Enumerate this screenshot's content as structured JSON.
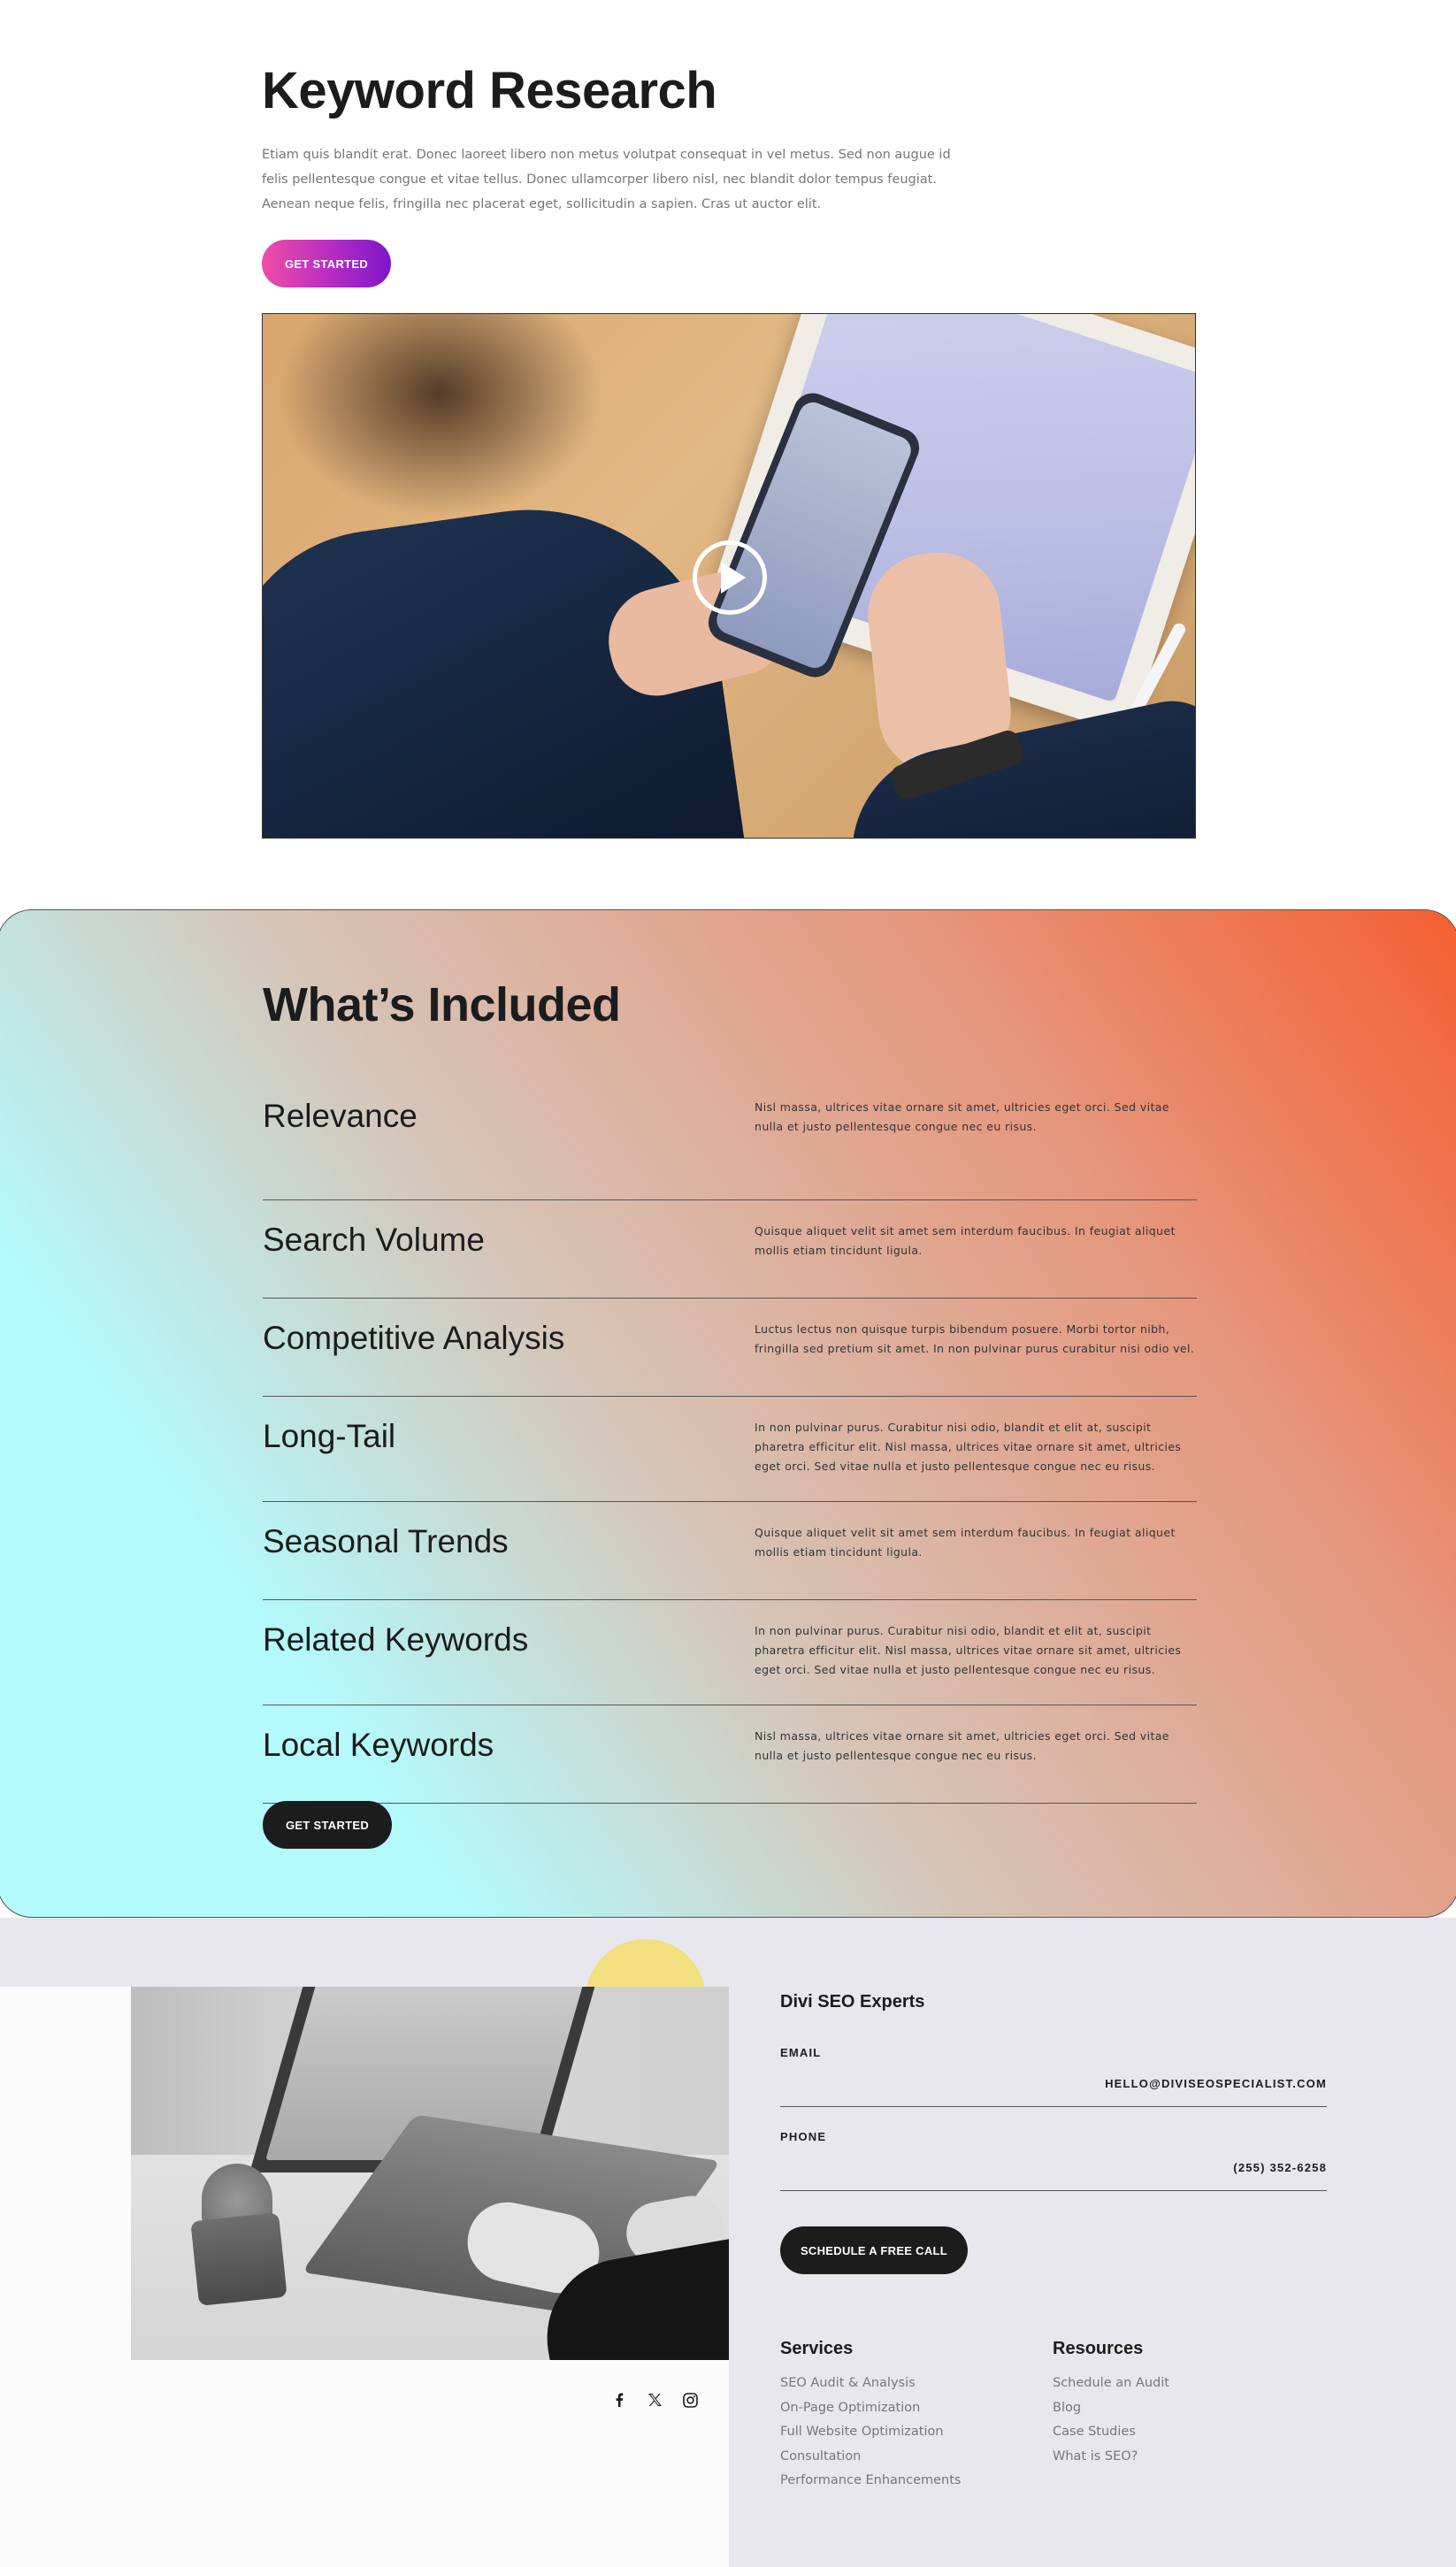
{
  "hero": {
    "title": "Keyword Research",
    "description": "Etiam quis blandit erat. Donec laoreet libero non metus volutpat consequat in vel metus. Sed non augue id felis pellentesque congue et vitae tellus. Donec ullamcorper libero nisl, nec blandit dolor tempus feugiat. Aenean neque felis, fringilla nec placerat eget, sollicitudin a sapien. Cras ut auctor elit.",
    "cta_label": "GET STARTED",
    "cta_gradient": [
      "#ef4da6",
      "#7d16c9"
    ],
    "video_icon": "play-icon"
  },
  "included": {
    "title": "What’s Included",
    "items": [
      {
        "title": "Relevance",
        "text": "Nisl massa, ultrices vitae ornare sit amet, ultricies eget orci. Sed vitae nulla et justo pellentesque congue nec eu risus."
      },
      {
        "title": "Search Volume",
        "text": "Quisque aliquet velit sit amet sem interdum faucibus. In feugiat aliquet mollis etiam tincidunt ligula."
      },
      {
        "title": "Competitive Analysis",
        "text": "Luctus lectus non quisque turpis bibendum posuere. Morbi tortor nibh, fringilla sed pretium sit amet. In non pulvinar purus curabitur nisi odio vel."
      },
      {
        "title": "Long-Tail",
        "text": "In non pulvinar purus. Curabitur nisi odio, blandit et elit at, suscipit pharetra efficitur elit. Nisl massa, ultrices vitae ornare sit amet, ultricies eget orci. Sed vitae nulla et justo pellentesque congue nec eu risus."
      },
      {
        "title": "Seasonal Trends",
        "text": "Quisque aliquet velit sit amet sem interdum faucibus. In feugiat aliquet mollis etiam tincidunt ligula."
      },
      {
        "title": "Related Keywords",
        "text": "In non pulvinar purus. Curabitur nisi odio, blandit et elit at, suscipit pharetra efficitur elit. Nisl massa, ultrices vitae ornare sit amet, ultricies eget orci. Sed vitae nulla et justo pellentesque congue nec eu risus."
      },
      {
        "title": "Local Keywords",
        "text": "Nisl massa, ultrices vitae ornare sit amet, ultricies eget orci. Sed vitae nulla et justo pellentesque congue nec eu risus."
      }
    ],
    "cta_label": "GET STARTED",
    "gradient_colors": [
      "#b3fbfd",
      "#d6c4b7",
      "#f55f32"
    ]
  },
  "contact": {
    "company": "Divi SEO Experts",
    "email_label": "EMAIL",
    "email_value": "HELLO@DIVISEOSPECIALIST.COM",
    "phone_label": "PHONE",
    "phone_value": "(255) 352-6258",
    "call_label": "SCHEDULE A FREE CALL",
    "accent_yellow": "#f2df7f",
    "socials": [
      "facebook-icon",
      "x-icon",
      "instagram-icon"
    ],
    "services": {
      "heading": "Services",
      "links": [
        "SEO Audit & Analysis",
        "On-Page Optimization",
        "Full Website Optimization",
        "Consultation",
        "Performance Enhancements"
      ]
    },
    "resources": {
      "heading": "Resources",
      "links": [
        "Schedule an Audit",
        "Blog",
        "Case Studies",
        "What is SEO?"
      ]
    }
  }
}
